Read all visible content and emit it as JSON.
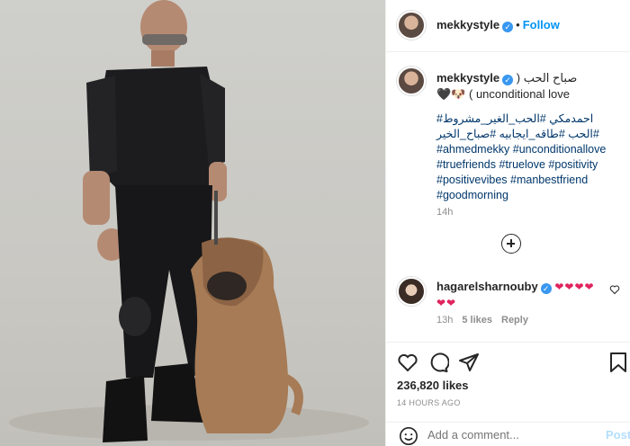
{
  "post": {
    "owner": "mekkystyle",
    "follow_label": "Follow",
    "separator": "•",
    "caption_user": "mekkystyle",
    "caption_text": "صباح الحب ( unconditional love ) 🐶🖤",
    "hashtags": [
      "#احمدمكي",
      "#الحب_الغير_مشروط",
      "#الحب",
      "#طاقه_ايجابيه",
      "#صباح_الخير",
      "#ahmedmekky",
      "#unconditionallove",
      "#truefriends",
      "#truelove",
      "#positivity",
      "#positivevibes",
      "#manbestfriend",
      "#goodmorning"
    ],
    "caption_time": "14h",
    "likes": "236,820 likes",
    "posted_ago": "14 HOURS AGO"
  },
  "comment": {
    "user": "hagarelsharnouby",
    "text": "❤❤❤❤❤❤",
    "time": "13h",
    "likes": "5 likes",
    "reply_label": "Reply"
  },
  "composer": {
    "placeholder": "Add a comment...",
    "post_label": "Post"
  },
  "icons": {
    "verified": "verified-badge-icon",
    "like": "heart-icon",
    "comment": "comment-bubble-icon",
    "share": "paper-plane-icon",
    "save": "bookmark-icon",
    "emoji": "emoji-smile-icon",
    "more_comments": "plus-circle-icon"
  },
  "colors": {
    "accent": "#0095f6",
    "hashtag": "#00376b",
    "heart": "#e0245e"
  }
}
